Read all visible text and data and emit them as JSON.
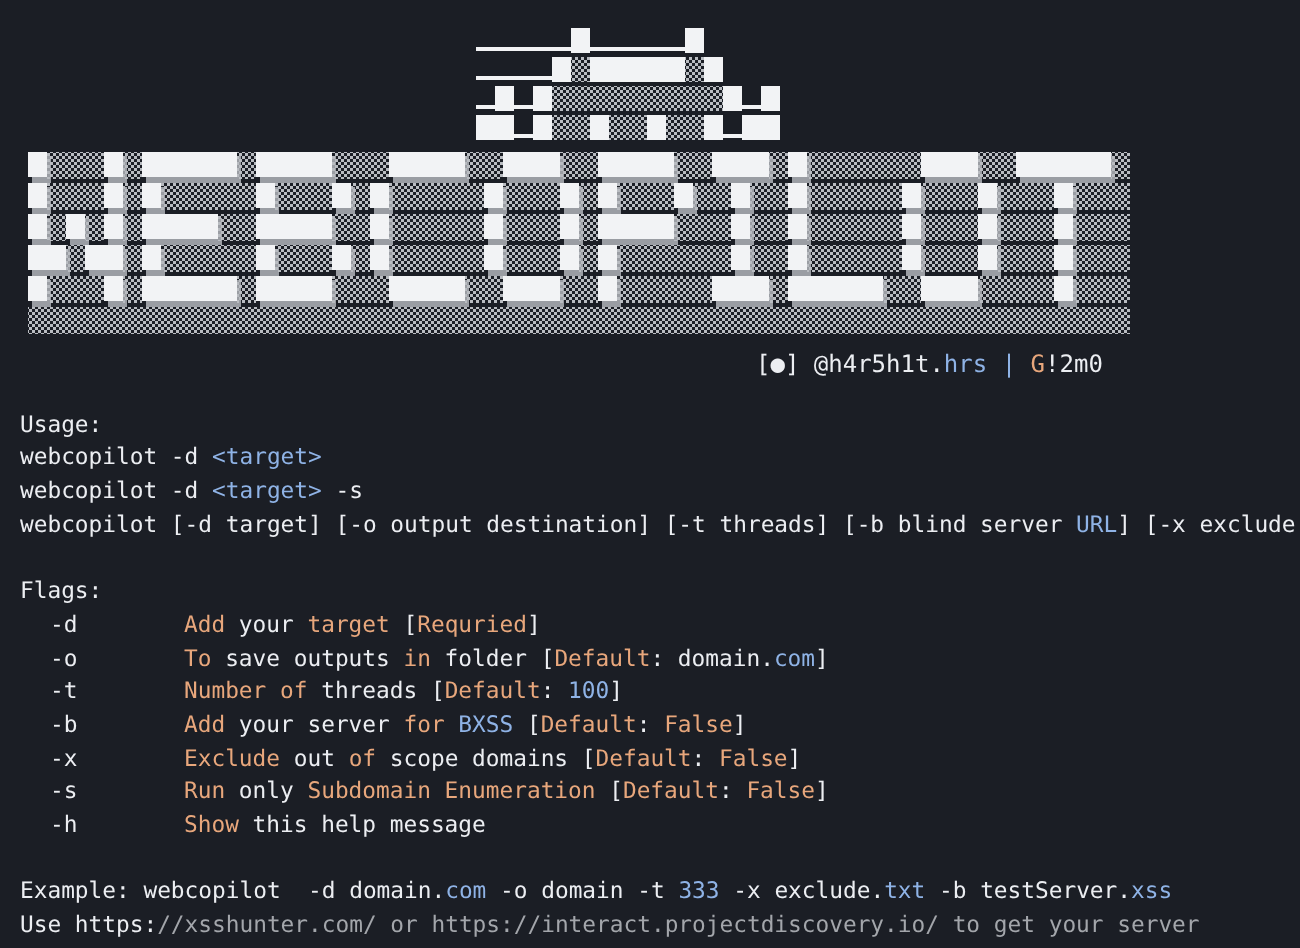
{
  "banner_credit": [
    {
      "text": "[●] @h4r5h1t.",
      "kind": "plain"
    },
    {
      "text": "hrs | ",
      "kind": "value"
    },
    {
      "text": "G",
      "kind": "keyword"
    },
    {
      "text": "!2m0",
      "kind": "plain"
    }
  ],
  "usage": {
    "heading": "Usage:",
    "lines": [
      [
        {
          "text": "webcopilot -d ",
          "kind": "plain"
        },
        {
          "text": "<target>",
          "kind": "value"
        }
      ],
      [
        {
          "text": "webcopilot -d ",
          "kind": "plain"
        },
        {
          "text": "<target>",
          "kind": "value"
        },
        {
          "text": " -s",
          "kind": "plain"
        }
      ],
      [
        {
          "text": "webcopilot [-d target] [-o output destination] [-t threads] [-b blind server ",
          "kind": "plain"
        },
        {
          "text": "URL",
          "kind": "value"
        },
        {
          "text": "] [-x exclude",
          "kind": "plain"
        }
      ]
    ]
  },
  "flags": {
    "heading": "Flags:",
    "items": [
      {
        "flag": "-d",
        "description": [
          {
            "text": "Add",
            "kind": "keyword"
          },
          {
            "text": " your ",
            "kind": "plain"
          },
          {
            "text": "target",
            "kind": "keyword"
          },
          {
            "text": " [",
            "kind": "plain"
          },
          {
            "text": "Requried",
            "kind": "keyword"
          },
          {
            "text": "]",
            "kind": "plain"
          }
        ]
      },
      {
        "flag": "-o",
        "description": [
          {
            "text": "To",
            "kind": "keyword"
          },
          {
            "text": " save outputs ",
            "kind": "plain"
          },
          {
            "text": "in",
            "kind": "keyword"
          },
          {
            "text": " folder [",
            "kind": "plain"
          },
          {
            "text": "Default",
            "kind": "keyword"
          },
          {
            "text": ": domain.",
            "kind": "plain"
          },
          {
            "text": "com",
            "kind": "value"
          },
          {
            "text": "]",
            "kind": "plain"
          }
        ]
      },
      {
        "flag": "-t",
        "description": [
          {
            "text": "Number",
            "kind": "keyword"
          },
          {
            "text": " of",
            "kind": "keyword"
          },
          {
            "text": " threads [",
            "kind": "plain"
          },
          {
            "text": "Default",
            "kind": "keyword"
          },
          {
            "text": ": ",
            "kind": "plain"
          },
          {
            "text": "100",
            "kind": "value"
          },
          {
            "text": "]",
            "kind": "plain"
          }
        ]
      },
      {
        "flag": "-b",
        "description": [
          {
            "text": "Add",
            "kind": "keyword"
          },
          {
            "text": " your server ",
            "kind": "plain"
          },
          {
            "text": "for",
            "kind": "keyword"
          },
          {
            "text": " BXSS",
            "kind": "value"
          },
          {
            "text": " [",
            "kind": "plain"
          },
          {
            "text": "Default",
            "kind": "keyword"
          },
          {
            "text": ": ",
            "kind": "plain"
          },
          {
            "text": "False",
            "kind": "keyword"
          },
          {
            "text": "]",
            "kind": "plain"
          }
        ]
      },
      {
        "flag": "-x",
        "description": [
          {
            "text": "Exclude",
            "kind": "keyword"
          },
          {
            "text": " out ",
            "kind": "plain"
          },
          {
            "text": "of",
            "kind": "keyword"
          },
          {
            "text": " scope domains [",
            "kind": "plain"
          },
          {
            "text": "Default",
            "kind": "keyword"
          },
          {
            "text": ": ",
            "kind": "plain"
          },
          {
            "text": "False",
            "kind": "keyword"
          },
          {
            "text": "]",
            "kind": "plain"
          }
        ]
      },
      {
        "flag": "-s",
        "description": [
          {
            "text": "Run",
            "kind": "keyword"
          },
          {
            "text": " only ",
            "kind": "plain"
          },
          {
            "text": "Subdomain Enumeration",
            "kind": "keyword"
          },
          {
            "text": " [",
            "kind": "plain"
          },
          {
            "text": "Default",
            "kind": "keyword"
          },
          {
            "text": ": ",
            "kind": "plain"
          },
          {
            "text": "False",
            "kind": "keyword"
          },
          {
            "text": "]",
            "kind": "plain"
          }
        ]
      },
      {
        "flag": "-h",
        "description": [
          {
            "text": "Show",
            "kind": "keyword"
          },
          {
            "text": " this help message",
            "kind": "plain"
          }
        ]
      }
    ]
  },
  "example": [
    {
      "text": "Example: webcopilot  -d domain.",
      "kind": "plain"
    },
    {
      "text": "com",
      "kind": "value"
    },
    {
      "text": " -o domain -t ",
      "kind": "plain"
    },
    {
      "text": "333",
      "kind": "value"
    },
    {
      "text": " -x exclude.",
      "kind": "plain"
    },
    {
      "text": "txt",
      "kind": "value"
    },
    {
      "text": " -b testServer.",
      "kind": "plain"
    },
    {
      "text": "xss",
      "kind": "value"
    }
  ],
  "note": [
    {
      "text": "Use https:",
      "kind": "plain"
    },
    {
      "text": "//xsshunter.com/ or https://interact.projectdiscovery.io/ to get your server",
      "kind": "comment"
    }
  ]
}
